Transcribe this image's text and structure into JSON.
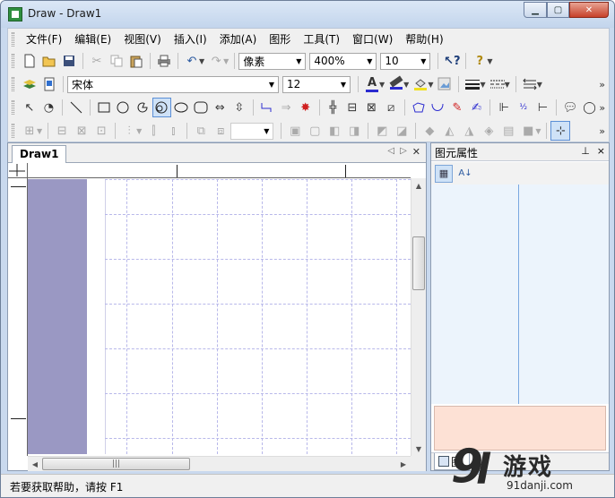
{
  "window": {
    "title": "Draw - Draw1",
    "controls": [
      "min-icon",
      "max-icon",
      "close-icon"
    ]
  },
  "menu": [
    "文件(F)",
    "编辑(E)",
    "视图(V)",
    "插入(I)",
    "添加(A)",
    "图形",
    "工具(T)",
    "窗口(W)",
    "帮助(H)"
  ],
  "toolbar1": {
    "unit": "像素",
    "zoom": "400%",
    "value": "10"
  },
  "toolbar2": {
    "font": "宋体",
    "size": "12",
    "font_color_letter": "A"
  },
  "document": {
    "tab": "Draw1"
  },
  "panel": {
    "title": "图元属性",
    "pin": "ᵖ",
    "close": "×",
    "bottom_tab": "图."
  },
  "status": {
    "text": "若要获取帮助，请按 F1"
  },
  "watermark": {
    "brand_digit": "9",
    "brand_text": "游戏",
    "url": "91danji.com"
  },
  "colors": {
    "margin": "#9a98c3",
    "grid": "#b8b8ea",
    "propgrid": "#ecf4fc",
    "propdesc": "#fde1d5"
  }
}
